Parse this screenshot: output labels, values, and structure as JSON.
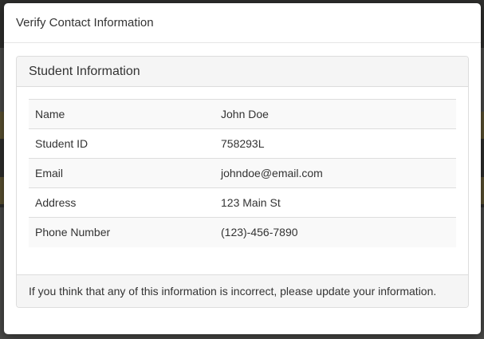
{
  "modal": {
    "title": "Verify Contact Information"
  },
  "panel": {
    "heading": "Student Information",
    "rows": [
      {
        "label": "Name",
        "value": "John Doe"
      },
      {
        "label": "Student ID",
        "value": "758293L"
      },
      {
        "label": "Email",
        "value": "johndoe@email.com"
      },
      {
        "label": "Address",
        "value": "123 Main St"
      },
      {
        "label": "Phone Number",
        "value": "(123)-456-7890"
      }
    ],
    "footer": "If you think that any of this information is incorrect, please update your information."
  },
  "colors": {
    "backdrop": "#2e2e2c",
    "band": "#5b5231",
    "stripe": "#f9f9f9",
    "border": "#dddddd"
  }
}
